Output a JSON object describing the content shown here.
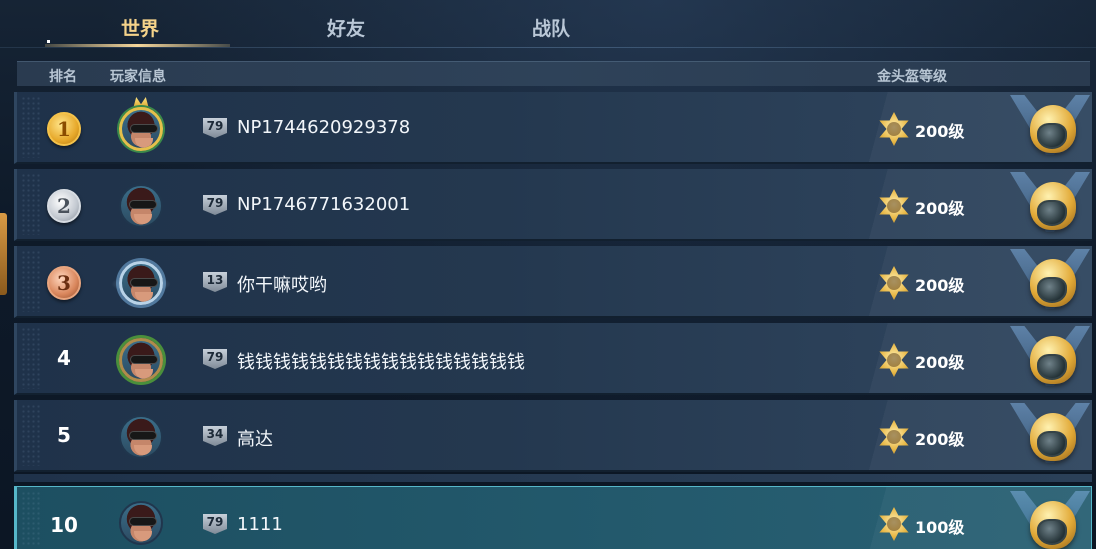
{
  "tabs": [
    {
      "label": "世界",
      "active": true
    },
    {
      "label": "好友",
      "active": false
    },
    {
      "label": "战队",
      "active": false
    }
  ],
  "header": {
    "rank": "排名",
    "player_info": "玩家信息",
    "helmet_level": "金头盔等级"
  },
  "rows": [
    {
      "rank": "1",
      "medal": "gold",
      "frame": "gold",
      "level": "79",
      "name": "NP1744620929378",
      "helmet_level": "200级"
    },
    {
      "rank": "2",
      "medal": "silver",
      "frame": "plain",
      "level": "79",
      "name": "NP1746771632001",
      "helmet_level": "200级"
    },
    {
      "rank": "3",
      "medal": "bronze",
      "frame": "silver",
      "level": "13",
      "name": "你干嘛哎哟",
      "helmet_level": "200级"
    },
    {
      "rank": "4",
      "medal": "none",
      "frame": "leaf",
      "level": "79",
      "name": "钱钱钱钱钱钱钱钱钱钱钱钱钱钱钱钱",
      "helmet_level": "200级"
    },
    {
      "rank": "5",
      "medal": "none",
      "frame": "plain",
      "level": "34",
      "name": "高达",
      "helmet_level": "200级"
    }
  ],
  "self_row": {
    "rank": "10",
    "level": "79",
    "name": "1111",
    "helmet_level": "100级"
  },
  "colors": {
    "accent_gold": "#f5d38a",
    "self_highlight": "#56b7c9"
  }
}
